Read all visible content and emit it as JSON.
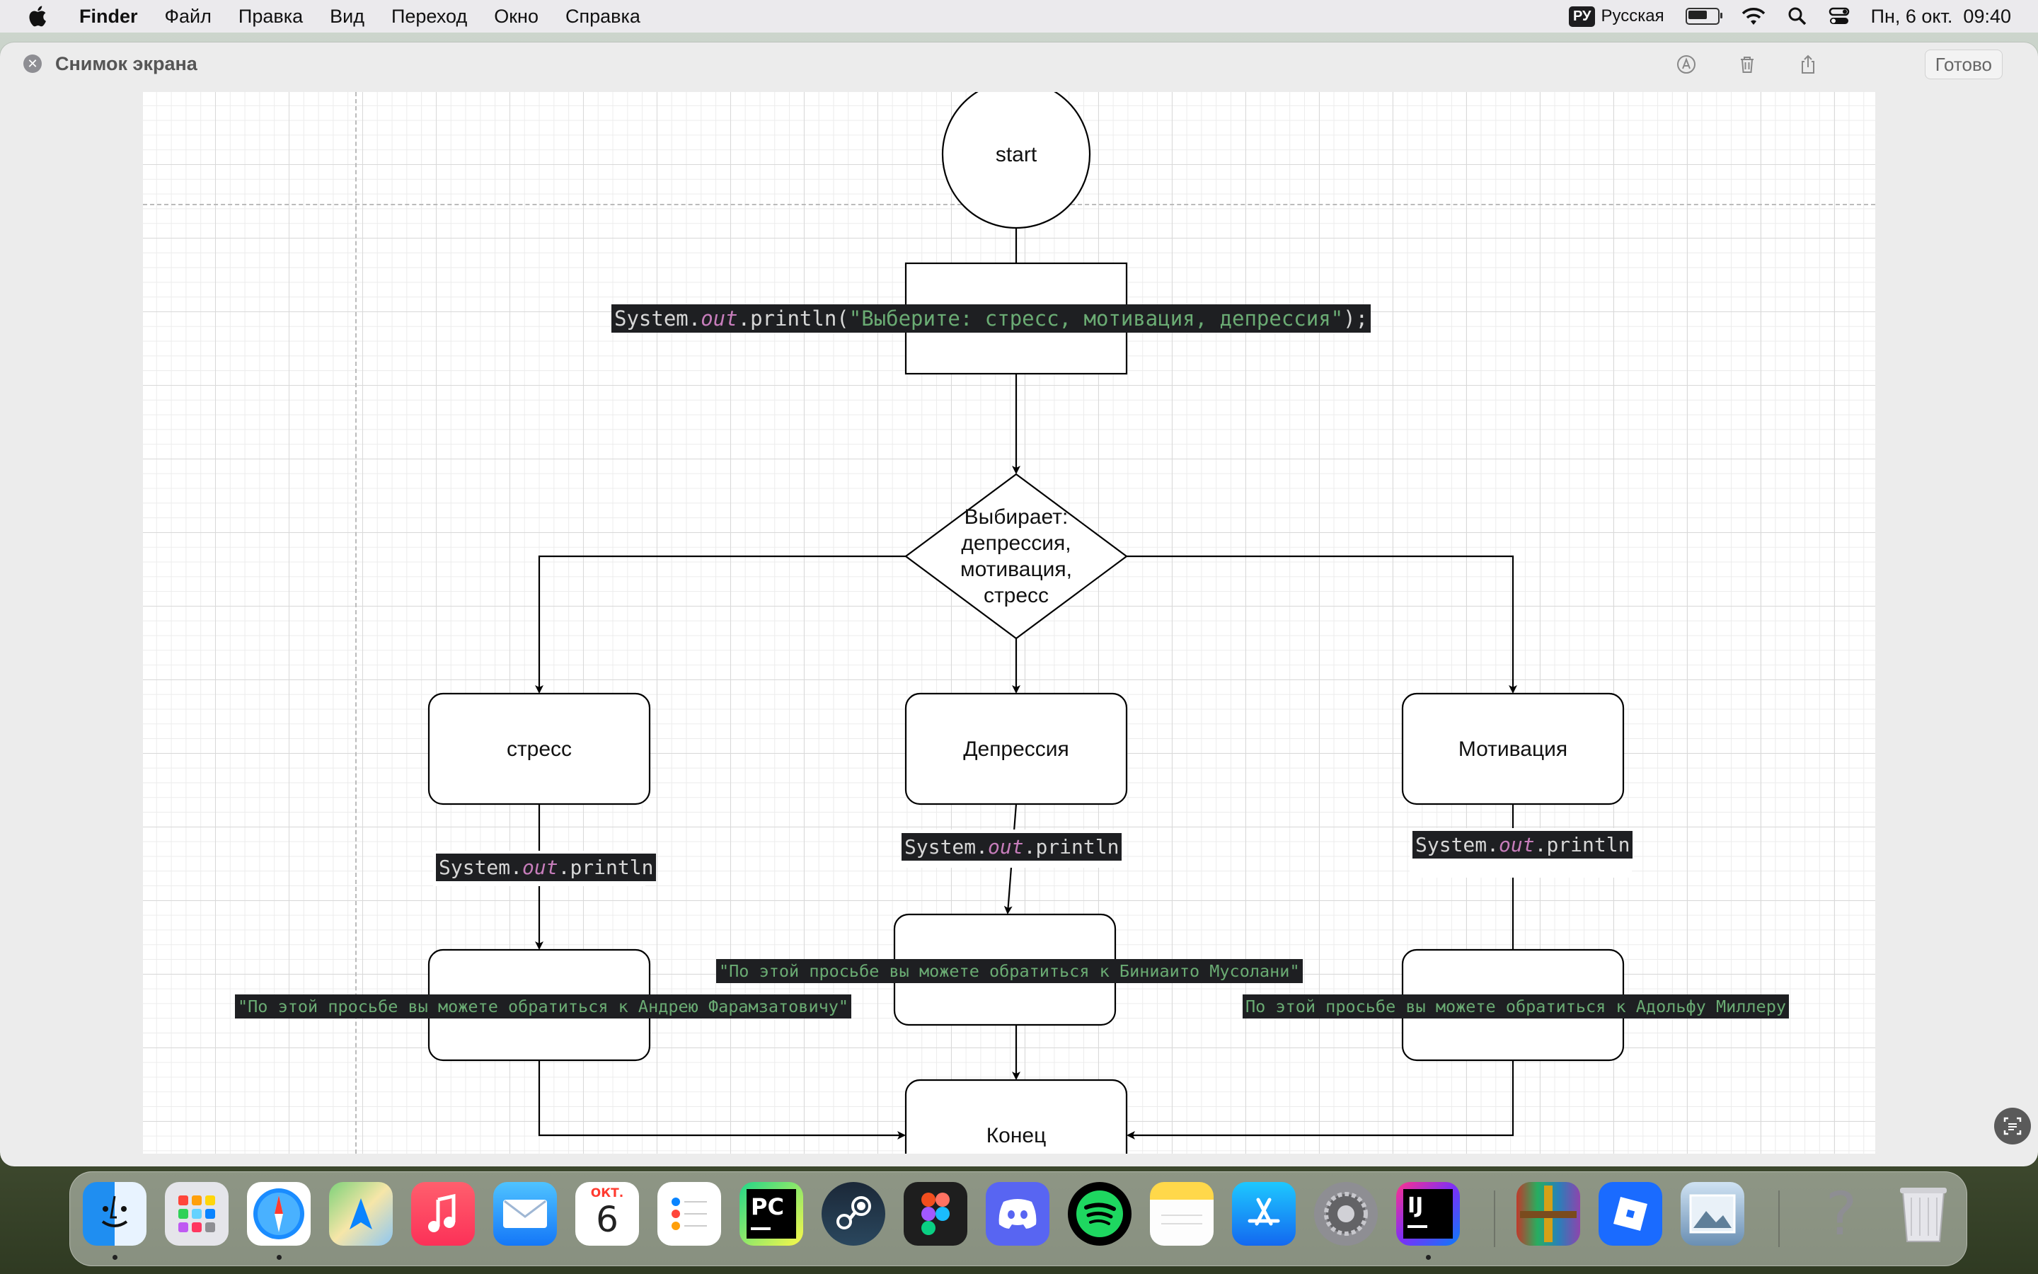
{
  "menubar": {
    "app_name": "Finder",
    "items": [
      "Файл",
      "Правка",
      "Вид",
      "Переход",
      "Окно",
      "Справка"
    ],
    "input_badge": "РУ",
    "input_language": "Русская",
    "battery_level": 0.65,
    "datetime": "Пн, 6 окт.  09:40"
  },
  "window": {
    "title": "Снимок экрана",
    "done_label": "Готово"
  },
  "flowchart": {
    "start": "start",
    "decision": "Выбирает:\nдепрессия,\nмотивация,\nстресс",
    "stress": "стресс",
    "depression": "Депрессия",
    "motivation": "Мотивация",
    "end": "Конец",
    "println_full_prefix": "System.",
    "println_out": "out",
    "println_full_mid": ".println(",
    "println_full_string": "\"Выберите: стресс, мотивация, депрессия\"",
    "println_full_suffix": ");",
    "println_method": ".println",
    "msg_stress": "\"По этой просьбе вы можете обратиться к Андрею Фарамзатовичу\"",
    "msg_depression": "\"По этой просьбе вы можете обратиться к Биниаито Мусолани\"",
    "msg_motivation": "По этой просьбе вы можете обратиться к Адольфу Миллеру"
  },
  "dock": {
    "calendar_month": "ОКТ.",
    "calendar_day": "6",
    "pycharm_label": "PC",
    "intellij_label": "IJ",
    "help_label": "?"
  },
  "colors": {
    "code_bg": "#1e1f22",
    "code_string": "#6aab73",
    "code_out": "#c77dbb"
  }
}
